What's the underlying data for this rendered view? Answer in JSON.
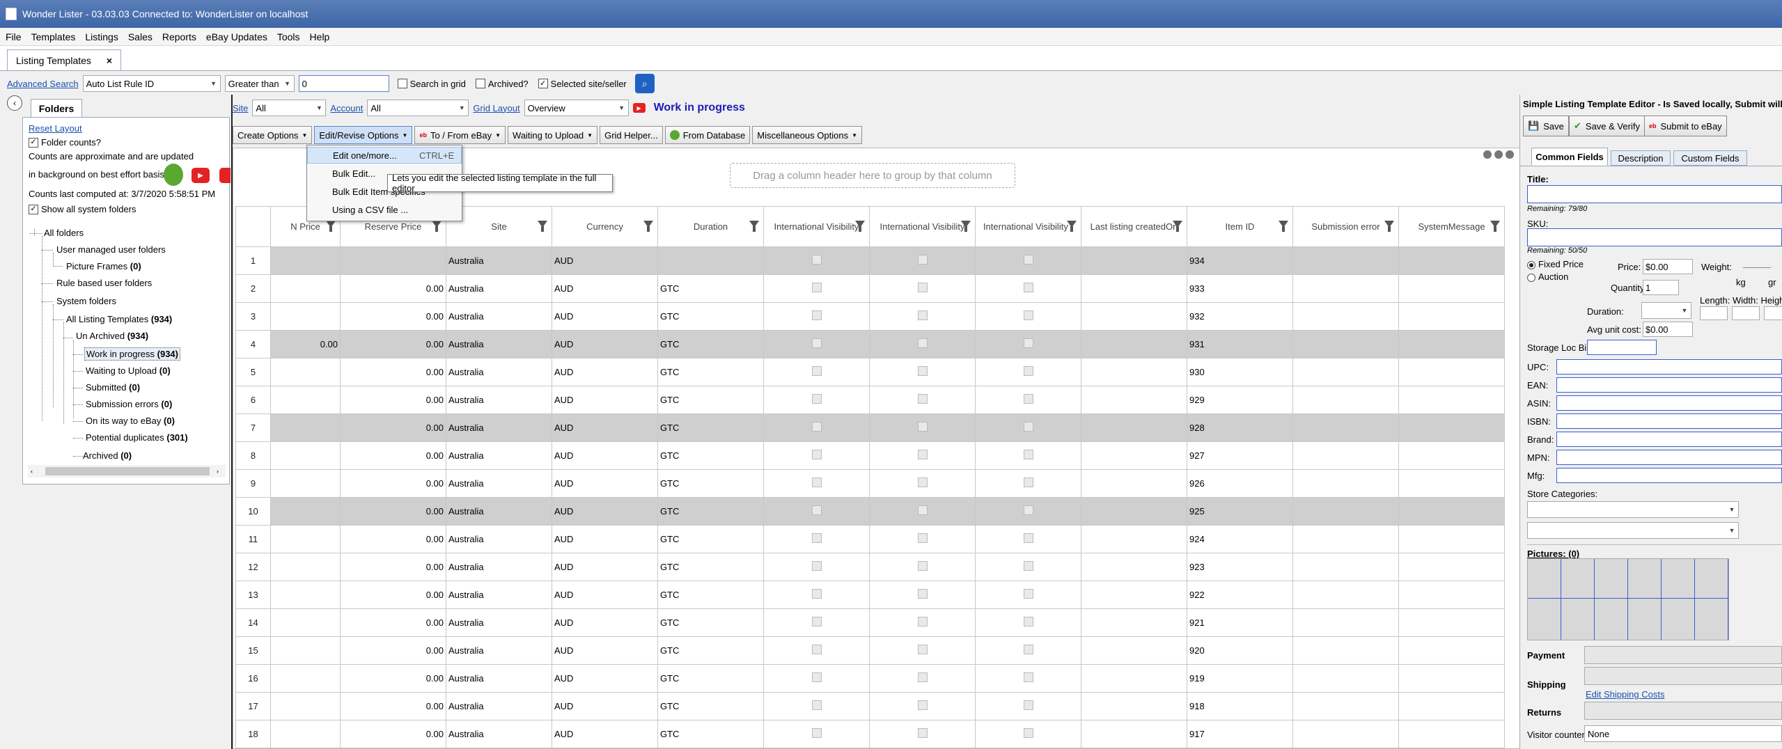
{
  "window": {
    "title": "Wonder Lister - 03.03.03 Connected to: WonderLister on localhost"
  },
  "menu": [
    "File",
    "Templates",
    "Listings",
    "Sales",
    "Reports",
    "eBay Updates",
    "Tools",
    "Help"
  ],
  "doc_tab": {
    "label": "Listing Templates",
    "close": "×"
  },
  "search": {
    "advanced_link": "Advanced Search",
    "field": "Auto List Rule ID",
    "operator": "Greater than",
    "value": "0",
    "search_in_grid": "Search in grid",
    "archived": "Archived?",
    "selected_site": "Selected site/seller"
  },
  "folders": {
    "tab": "Folders",
    "reset_layout": "Reset Layout",
    "folder_counts": "Folder counts?",
    "note1": "Counts are approximate and are updated",
    "note2": "in background on best effort basis",
    "computed": "Counts last computed at: 3/7/2020 5:58:51 PM",
    "show_system": "Show all system folders",
    "tree": [
      {
        "label": "All folders",
        "count": ""
      },
      {
        "label": "User managed user folders",
        "count": ""
      },
      {
        "label": "Picture Frames",
        "count": "(0)"
      },
      {
        "label": "Rule based user folders",
        "count": ""
      },
      {
        "label": "System folders",
        "count": ""
      },
      {
        "label": "All Listing Templates",
        "count": "(934)"
      },
      {
        "label": "Un Archived",
        "count": "(934)"
      },
      {
        "label": "Work in progress",
        "count": "(934)"
      },
      {
        "label": "Waiting to Upload",
        "count": "(0)"
      },
      {
        "label": "Submitted",
        "count": "(0)"
      },
      {
        "label": "Submission errors",
        "count": "(0)"
      },
      {
        "label": "On its way to eBay",
        "count": "(0)"
      },
      {
        "label": "Potential duplicates",
        "count": "(301)"
      },
      {
        "label": "Archived",
        "count": "(0)"
      }
    ]
  },
  "filters": {
    "site_label": "Site",
    "site_value": "All",
    "account_label": "Account",
    "account_value": "All",
    "layout_label": "Grid Layout",
    "layout_value": "Overview",
    "status": "Work in progress"
  },
  "toolbar": [
    "Create Options",
    "Edit/Revise Options",
    "To / From eBay",
    "Waiting to Upload",
    "Grid Helper...",
    "From Database",
    "Miscellaneous Options"
  ],
  "dropdown": [
    {
      "label": "Edit one/more...",
      "shortcut": "CTRL+E"
    },
    {
      "label": "Bulk Edit...",
      "shortcut": ""
    },
    {
      "label": "Bulk Edit Item specifics",
      "shortcut": ""
    },
    {
      "label": "Using a CSV file ...",
      "shortcut": ""
    }
  ],
  "tooltip": "Lets you edit the selected listing template in the full editor",
  "group_zone": "Drag a column header here to group by that column",
  "grid": {
    "columns": [
      "N Price",
      "Reserve Price",
      "Site",
      "Currency",
      "Duration",
      "International Visibility",
      "International Visibility",
      "International Visibility .",
      "Last listing createdOn",
      "Item ID",
      "Submission error",
      "SystemMessage"
    ],
    "rows": [
      {
        "n": "1",
        "nprice": "",
        "reserve": "",
        "site": "Australia",
        "currency": "AUD",
        "duration": "",
        "item": "934",
        "sel": true
      },
      {
        "n": "2",
        "nprice": "",
        "reserve": "0.00",
        "site": "Australia",
        "currency": "AUD",
        "duration": "GTC",
        "item": "933",
        "sel": false
      },
      {
        "n": "3",
        "nprice": "",
        "reserve": "0.00",
        "site": "Australia",
        "currency": "AUD",
        "duration": "GTC",
        "item": "932",
        "sel": false
      },
      {
        "n": "4",
        "nprice": "0.00",
        "reserve": "0.00",
        "site": "Australia",
        "currency": "AUD",
        "duration": "GTC",
        "item": "931",
        "sel": true
      },
      {
        "n": "5",
        "nprice": "",
        "reserve": "0.00",
        "site": "Australia",
        "currency": "AUD",
        "duration": "GTC",
        "item": "930",
        "sel": false
      },
      {
        "n": "6",
        "nprice": "",
        "reserve": "0.00",
        "site": "Australia",
        "currency": "AUD",
        "duration": "GTC",
        "item": "929",
        "sel": false
      },
      {
        "n": "7",
        "nprice": "",
        "reserve": "0.00",
        "site": "Australia",
        "currency": "AUD",
        "duration": "GTC",
        "item": "928",
        "sel": true
      },
      {
        "n": "8",
        "nprice": "",
        "reserve": "0.00",
        "site": "Australia",
        "currency": "AUD",
        "duration": "GTC",
        "item": "927",
        "sel": false
      },
      {
        "n": "9",
        "nprice": "",
        "reserve": "0.00",
        "site": "Australia",
        "currency": "AUD",
        "duration": "GTC",
        "item": "926",
        "sel": false
      },
      {
        "n": "10",
        "nprice": "",
        "reserve": "0.00",
        "site": "Australia",
        "currency": "AUD",
        "duration": "GTC",
        "item": "925",
        "sel": true
      },
      {
        "n": "11",
        "nprice": "",
        "reserve": "0.00",
        "site": "Australia",
        "currency": "AUD",
        "duration": "GTC",
        "item": "924",
        "sel": false
      },
      {
        "n": "12",
        "nprice": "",
        "reserve": "0.00",
        "site": "Australia",
        "currency": "AUD",
        "duration": "GTC",
        "item": "923",
        "sel": false
      },
      {
        "n": "13",
        "nprice": "",
        "reserve": "0.00",
        "site": "Australia",
        "currency": "AUD",
        "duration": "GTC",
        "item": "922",
        "sel": false
      },
      {
        "n": "14",
        "nprice": "",
        "reserve": "0.00",
        "site": "Australia",
        "currency": "AUD",
        "duration": "GTC",
        "item": "921",
        "sel": false
      },
      {
        "n": "15",
        "nprice": "",
        "reserve": "0.00",
        "site": "Australia",
        "currency": "AUD",
        "duration": "GTC",
        "item": "920",
        "sel": false
      },
      {
        "n": "16",
        "nprice": "",
        "reserve": "0.00",
        "site": "Australia",
        "currency": "AUD",
        "duration": "GTC",
        "item": "919",
        "sel": false
      },
      {
        "n": "17",
        "nprice": "",
        "reserve": "0.00",
        "site": "Australia",
        "currency": "AUD",
        "duration": "GTC",
        "item": "918",
        "sel": false
      },
      {
        "n": "18",
        "nprice": "",
        "reserve": "0.00",
        "site": "Australia",
        "currency": "AUD",
        "duration": "GTC",
        "item": "917",
        "sel": false
      }
    ]
  },
  "editor": {
    "header": "Simple Listing Template Editor - Is Saved locally, Submit will creat",
    "save": "Save",
    "save_verify": "Save & Verify",
    "submit": "Submit to eBay",
    "tabs": [
      "Common Fields",
      "Description",
      "Custom Fields"
    ],
    "title_label": "Title:",
    "title_remaining": "Remaining: 79/80",
    "sku_label": "SKU:",
    "sku_remaining": "Remaining: 50/50",
    "fixed_price": "Fixed Price",
    "auction": "Auction",
    "price_label": "Price:",
    "price_value": "$0.00",
    "quantity_label": "Quantity:",
    "quantity_value": "1",
    "duration_label": "Duration:",
    "avg_cost_label": "Avg unit cost:",
    "avg_cost_value": "$0.00",
    "weight_label": "Weight:",
    "kg": "kg",
    "gr": "gr",
    "dims_label": "Length: Width:  Heigh",
    "storage_label": "Storage Loc Bin:",
    "codes": [
      "UPC:",
      "EAN:",
      "ASIN:",
      "ISBN:",
      "Brand:",
      "MPN:",
      "Mfg:"
    ],
    "store_categories": "Store Categories:",
    "pictures": "Pictures: (0)",
    "payment": "Payment",
    "shipping": "Shipping",
    "edit_shipping": "Edit Shipping Costs",
    "returns": "Returns",
    "visitor_label": "Visitor counter:",
    "visitor_value": "None"
  },
  "colors": {
    "titlebar": "#3e65a6",
    "link": "#1a4fb0",
    "status": "#1b1bb5",
    "selected_row": "#cfcfcf",
    "field_border": "#3a5fcd"
  }
}
